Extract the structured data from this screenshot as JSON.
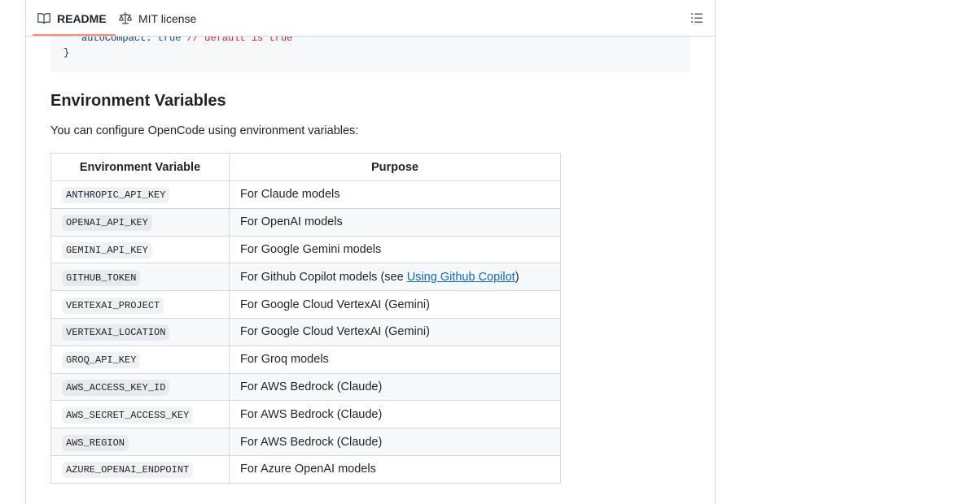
{
  "tabs": {
    "readme_label": "README",
    "license_label": "MIT license",
    "readme_icon": "book-icon",
    "license_icon": "law-scale-icon",
    "toc_icon": "list-unordered-icon"
  },
  "code": {
    "line1_prop": "autoCompact",
    "line1_sep": ": ",
    "line1_value": "true",
    "line1_comment": " // default is true",
    "line2": "}"
  },
  "section": {
    "heading": "Environment Variables",
    "intro": "You can configure OpenCode using environment variables:"
  },
  "table": {
    "headers": [
      "Environment Variable",
      "Purpose"
    ],
    "rows": [
      {
        "var": "ANTHROPIC_API_KEY",
        "purpose": "For Claude models"
      },
      {
        "var": "OPENAI_API_KEY",
        "purpose": "For OpenAI models"
      },
      {
        "var": "GEMINI_API_KEY",
        "purpose": "For Google Gemini models"
      },
      {
        "var": "GITHUB_TOKEN",
        "purpose_pre": "For Github Copilot models (see ",
        "purpose_link": "Using Github Copilot",
        "purpose_post": ")"
      },
      {
        "var": "VERTEXAI_PROJECT",
        "purpose": "For Google Cloud VertexAI (Gemini)"
      },
      {
        "var": "VERTEXAI_LOCATION",
        "purpose": "For Google Cloud VertexAI (Gemini)"
      },
      {
        "var": "GROQ_API_KEY",
        "purpose": "For Groq models"
      },
      {
        "var": "AWS_ACCESS_KEY_ID",
        "purpose": "For AWS Bedrock (Claude)"
      },
      {
        "var": "AWS_SECRET_ACCESS_KEY",
        "purpose": "For AWS Bedrock (Claude)"
      },
      {
        "var": "AWS_REGION",
        "purpose": "For AWS Bedrock (Claude)"
      },
      {
        "var": "AZURE_OPENAI_ENDPOINT",
        "purpose": "For Azure OpenAI models"
      }
    ]
  },
  "colors": {
    "accent_underline": "#fd8c73",
    "link": "#0969da",
    "border": "#d1d9e0",
    "code_bg": "#f6f8fa"
  }
}
